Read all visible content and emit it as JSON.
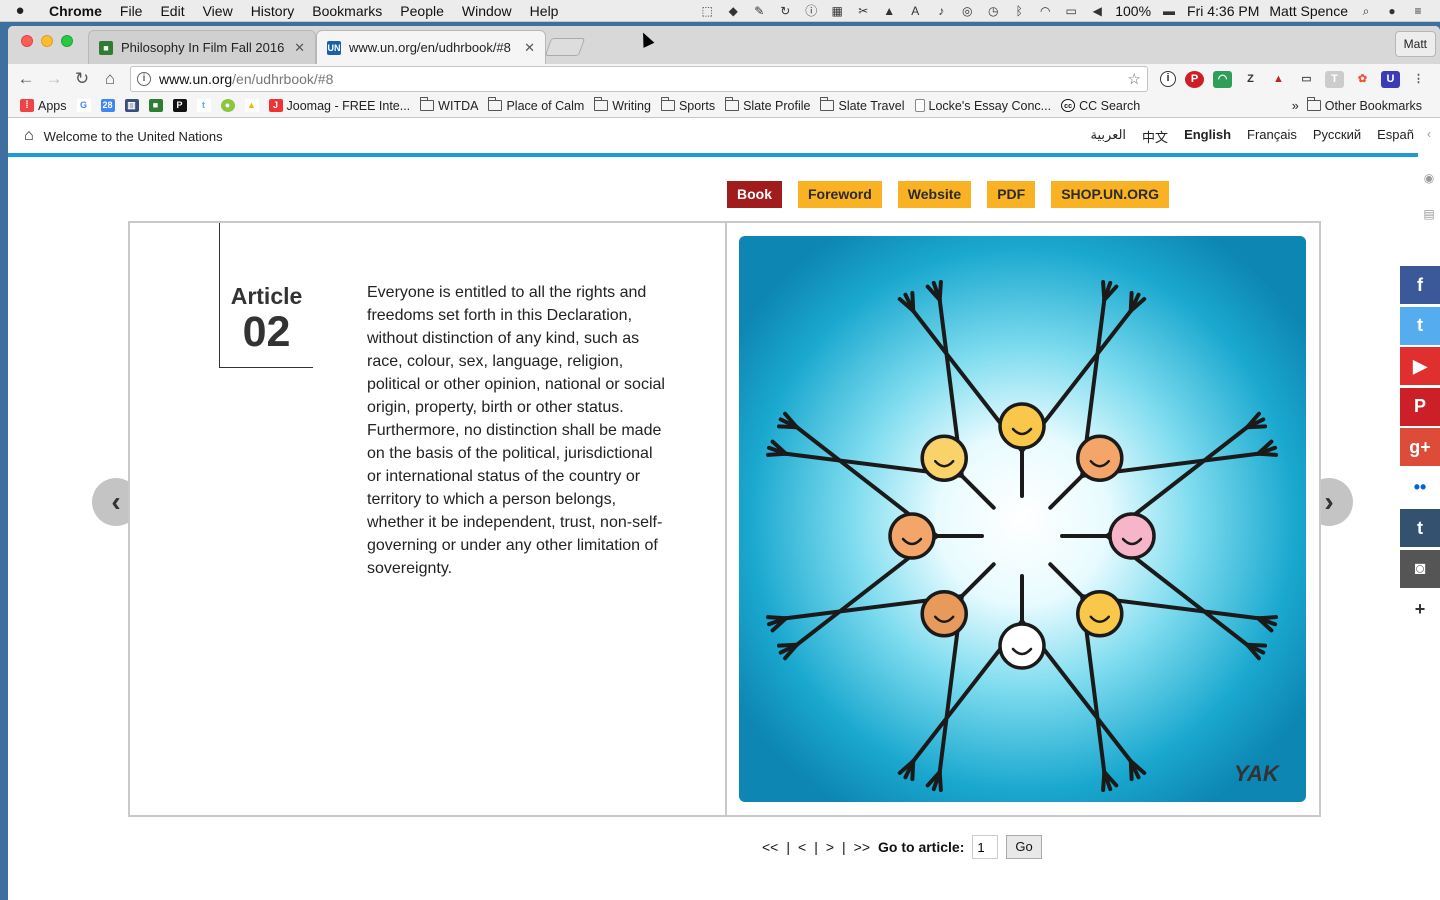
{
  "menubar": {
    "app": "Chrome",
    "items": [
      "File",
      "Edit",
      "View",
      "History",
      "Bookmarks",
      "People",
      "Window",
      "Help"
    ],
    "battery": "100%",
    "clock": "Fri 4:36 PM",
    "user": "Matt Spence"
  },
  "tabs": [
    {
      "title": "Philosophy In Film Fall 2016",
      "favicon": "classroom-icon",
      "favicon_color": "#2e7d32"
    },
    {
      "title": "www.un.org/en/udhrbook/#8",
      "favicon": "un-icon",
      "favicon_color": "#1a5fa8"
    }
  ],
  "profile_button": "Matt",
  "omnibox": {
    "host": "www.un.org",
    "path": "/en/udhrbook/#8"
  },
  "bookmarks": {
    "items": [
      {
        "label": "Apps",
        "type": "apps"
      },
      {
        "label": "",
        "type": "google"
      },
      {
        "label": "",
        "type": "calendar"
      },
      {
        "label": "",
        "type": "book"
      },
      {
        "label": "",
        "type": "classroom"
      },
      {
        "label": "",
        "type": "pocket"
      },
      {
        "label": "",
        "type": "twitter"
      },
      {
        "label": "",
        "type": "apple"
      },
      {
        "label": "",
        "type": "drive"
      },
      {
        "label": "Joomag - FREE Inte...",
        "type": "site"
      },
      {
        "label": "WITDA",
        "type": "folder"
      },
      {
        "label": "Place of Calm",
        "type": "folder"
      },
      {
        "label": "Writing",
        "type": "folder"
      },
      {
        "label": "Sports",
        "type": "folder"
      },
      {
        "label": "Slate Profile",
        "type": "folder"
      },
      {
        "label": "Slate Travel",
        "type": "folder"
      },
      {
        "label": "Locke's Essay Conc...",
        "type": "page"
      },
      {
        "label": "CC Search",
        "type": "cc"
      }
    ],
    "overflow": "»",
    "other": "Other Bookmarks"
  },
  "un_header": {
    "welcome": "Welcome to the United Nations",
    "languages": [
      "العربية",
      "中文",
      "English",
      "Français",
      "Русский",
      "Españ"
    ],
    "selected_language": "English"
  },
  "nav_buttons": [
    "Book",
    "Foreword",
    "Website",
    "PDF",
    "SHOP.UN.ORG"
  ],
  "active_nav": "Book",
  "article": {
    "label": "Article",
    "number": "02",
    "text": "Everyone is entitled to all the rights and freedoms set forth in this Declaration, without distinction of any kind, such as race, colour, sex, language, religion, political or other opinion, national or social origin, property, birth or other status. Furthermore, no distinction shall be made on the basis of the political, jurisdictional or international status of the country or territory to which a person belongs, whether it be independent, trust, non-self-governing or under any other limitation of sovereignty."
  },
  "illustration": {
    "signature": "YAK",
    "colors": {
      "bg": "#1aa8cf",
      "center": "#ffffff"
    }
  },
  "pager": {
    "first": "<<",
    "prev": "<",
    "next": ">",
    "last": ">>",
    "sep": "|",
    "goto_label": "Go to article:",
    "goto_value": "1",
    "go_button": "Go"
  },
  "social": [
    {
      "name": "facebook",
      "glyph": "f",
      "color": "#3b5998"
    },
    {
      "name": "twitter",
      "glyph": "t",
      "color": "#55acee"
    },
    {
      "name": "youtube",
      "glyph": "▶",
      "color": "#e02f2f"
    },
    {
      "name": "pinterest",
      "glyph": "P",
      "color": "#cb2027"
    },
    {
      "name": "googleplus",
      "glyph": "g+",
      "color": "#dd4b39"
    },
    {
      "name": "flickr",
      "glyph": "••",
      "color": "#ffffff"
    },
    {
      "name": "tumblr",
      "glyph": "t",
      "color": "#34526f"
    },
    {
      "name": "instagram",
      "glyph": "◙",
      "color": "#555555"
    },
    {
      "name": "more",
      "glyph": "+",
      "color": "#ffffff"
    }
  ]
}
